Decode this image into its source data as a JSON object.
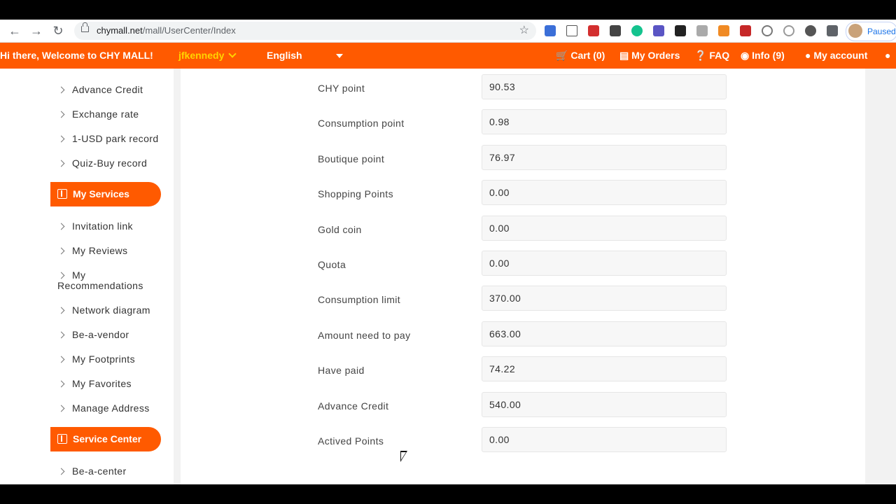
{
  "browser": {
    "url_host": "chymall.net",
    "url_path": "/mall/UserCenter/Index",
    "profile_status": "Paused"
  },
  "topbar": {
    "greeting": "Hi there,  Welcome to CHY MALL!",
    "username": "jfkennedy",
    "language": "English",
    "cart": "Cart (0)",
    "orders": "My Orders",
    "faq": "FAQ",
    "info": "Info (9)",
    "account": "My account"
  },
  "sidebar": {
    "links_top": [
      "Advance Credit",
      "Exchange rate",
      "1-USD park record",
      "Quiz-Buy record"
    ],
    "services_header": "My Services",
    "services_links": [
      "Invitation link",
      "My Reviews",
      "My",
      "Recommendations",
      "Network diagram",
      "Be-a-vendor",
      "My Footprints",
      "My Favorites",
      "Manage Address"
    ],
    "center_header": "Service Center",
    "center_links": [
      "Be-a-center"
    ]
  },
  "points": [
    {
      "label": "CHY point",
      "value": "90.53"
    },
    {
      "label": "Consumption point",
      "value": "0.98"
    },
    {
      "label": "Boutique point",
      "value": "76.97"
    },
    {
      "label": "Shopping Points",
      "value": "0.00"
    },
    {
      "label": "Gold coin",
      "value": "0.00"
    },
    {
      "label": "Quota",
      "value": "0.00"
    },
    {
      "label": "Consumption limit",
      "value": "370.00"
    },
    {
      "label": "Amount need to pay",
      "value": "663.00"
    },
    {
      "label": "Have paid",
      "value": "74.22"
    },
    {
      "label": "Advance Credit",
      "value": "540.00"
    },
    {
      "label": "Actived Points",
      "value": "0.00"
    }
  ],
  "colors": {
    "brand": "#ff5a00",
    "username": "#ffd400"
  }
}
